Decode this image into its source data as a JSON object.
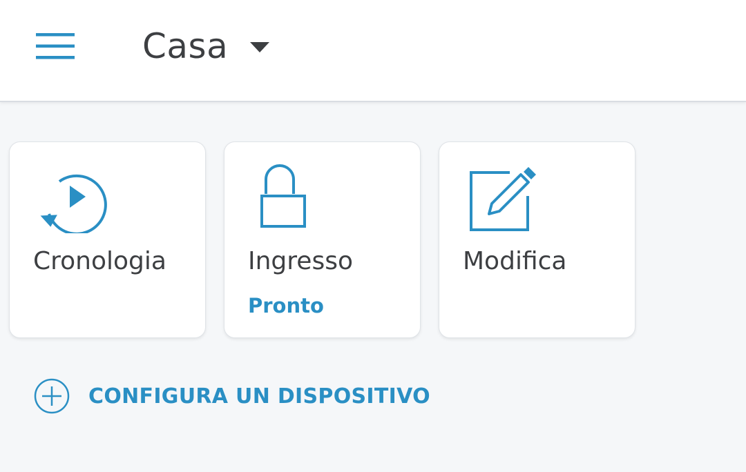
{
  "header": {
    "title": "Casa",
    "menu_icon": "hamburger-menu-icon",
    "dropdown_icon": "caret-down-icon"
  },
  "tiles": [
    {
      "label": "Cronologia",
      "sub": "",
      "icon": "history-play-icon"
    },
    {
      "label": "Ingresso",
      "sub": "Pronto",
      "icon": "lock-icon"
    },
    {
      "label": "Modifica",
      "sub": "",
      "icon": "edit-pencil-icon"
    }
  ],
  "setup": {
    "label": "CONFIGURA UN DISPOSITIVO",
    "icon": "add-circle-icon"
  },
  "colors": {
    "accent": "#2a8fc4",
    "text": "#3d3f42",
    "background": "#f5f7f9",
    "card": "#ffffff"
  }
}
